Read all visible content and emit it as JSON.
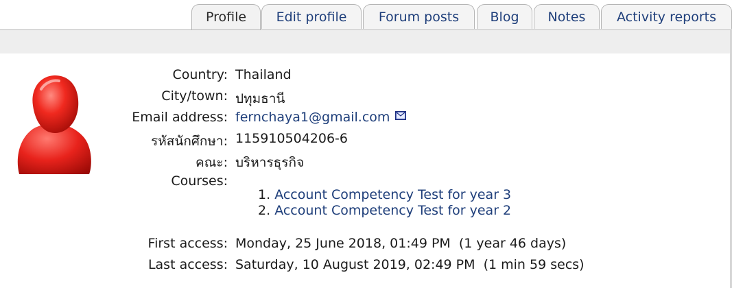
{
  "tabs": [
    {
      "label": "Profile",
      "active": true
    },
    {
      "label": "Edit profile"
    },
    {
      "label": "Forum posts"
    },
    {
      "label": "Blog"
    },
    {
      "label": "Notes"
    },
    {
      "label": "Activity reports"
    }
  ],
  "profile": {
    "country": {
      "label": "Country:",
      "value": "Thailand"
    },
    "city": {
      "label": "City/town:",
      "value": "ปทุมธานี"
    },
    "email": {
      "label": "Email address:",
      "value": "fernchaya1@gmail.com",
      "icon": "envelope-icon"
    },
    "student_id": {
      "label": "รหัสนักศึกษา:",
      "value": "115910504206-6"
    },
    "faculty": {
      "label": "คณะ:",
      "value": "บริหารธุรกิจ"
    },
    "courses": {
      "label": "Courses:",
      "items": [
        {
          "num": "1.",
          "name": "Account Competency Test for year 3"
        },
        {
          "num": "2.",
          "name": "Account Competency Test for year 2"
        }
      ]
    },
    "first_access": {
      "label": "First access:",
      "value": "Monday, 25 June 2018, 01:49 PM  (1 year 46 days)"
    },
    "last_access": {
      "label": "Last access:",
      "value": "Saturday, 10 August 2019, 02:49 PM  (1 min 59 secs)"
    }
  },
  "colors": {
    "link": "#1e3e7a",
    "avatar": "#e8231c"
  }
}
